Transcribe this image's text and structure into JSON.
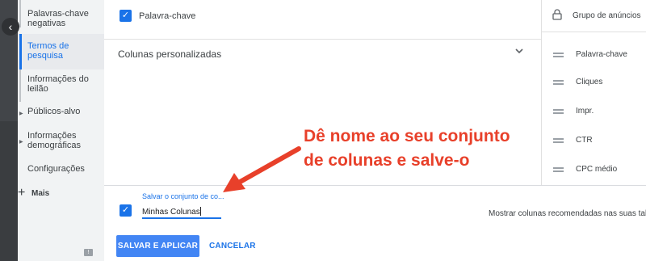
{
  "sidebar": {
    "collapse_glyph": "‹",
    "items": [
      {
        "label_line1": "Palavras-chave",
        "label_line2": "negativas",
        "active": false
      },
      {
        "label_line1": "Termos de",
        "label_line2": "pesquisa",
        "active": true
      },
      {
        "label_line1": "Informações do",
        "label_line2": "leilão",
        "active": false
      },
      {
        "label_line1": "Públicos-alvo",
        "label_line2": "",
        "has_arrow": true
      },
      {
        "label_line1": "Informações",
        "label_line2": "demográficas",
        "has_arrow": true
      },
      {
        "label_line1": "Configurações",
        "label_line2": ""
      }
    ],
    "more_label": "Mais",
    "more_plus": "+"
  },
  "main": {
    "keyword_checkbox_label": "Palavra-chave",
    "custom_columns_title": "Colunas personalizadas"
  },
  "right_column": {
    "header": "Grupo de anúncios",
    "items": [
      "Palavra-chave",
      "Cliques",
      "Impr.",
      "CTR",
      "CPC médio"
    ]
  },
  "bottom": {
    "save_set_label": "Salvar o conjunto de co...",
    "save_set_value": "Minhas Colunas",
    "recommend_text": "Mostrar colunas recomendadas nas suas tabe",
    "save_apply_label": "SALVAR E APLICAR",
    "cancel_label": "CANCELAR"
  },
  "annotation": {
    "line1": "Dê nome ao seu conjunto",
    "line2": "de colunas e salve-o",
    "color": "#e8402a"
  },
  "colors": {
    "accent": "#1a73e8",
    "button": "#4285f4",
    "sidebar_bg": "#f1f3f4",
    "dark_strip": "#424549"
  }
}
